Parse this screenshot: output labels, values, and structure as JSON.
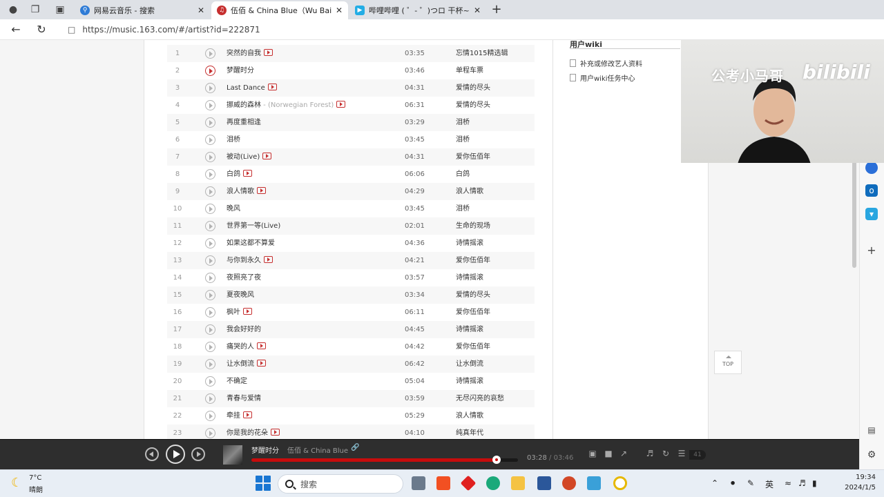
{
  "browser": {
    "tabs": [
      {
        "label": "网易云音乐 - 搜索",
        "favicon": "search-icon"
      },
      {
        "label": "伍佰 & China Blue（Wu Bai & C",
        "favicon": "netease-music-icon"
      },
      {
        "label": "哔哩哔哩 ( ゜- ゜)つロ 干杯~-bili",
        "favicon": "bilibili-icon"
      }
    ],
    "url": "https://music.163.com/#/artist?id=222871"
  },
  "songs": [
    {
      "num": "1",
      "title": "突然的自我",
      "sub": "",
      "mv": true,
      "duration": "03:35",
      "album": "忘情1015精选辑",
      "playing": false
    },
    {
      "num": "2",
      "title": "梦醒时分",
      "sub": "",
      "mv": false,
      "duration": "03:46",
      "album": "单程车票",
      "playing": true
    },
    {
      "num": "3",
      "title": "Last Dance",
      "sub": "",
      "mv": true,
      "duration": "04:31",
      "album": "爱情的尽头",
      "playing": false
    },
    {
      "num": "4",
      "title": "挪威的森林",
      "sub": " - (Norwegian Forest)",
      "mv": true,
      "duration": "06:31",
      "album": "爱情的尽头",
      "playing": false
    },
    {
      "num": "5",
      "title": "再度重相逢",
      "sub": "",
      "mv": false,
      "duration": "03:29",
      "album": "泪桥",
      "playing": false
    },
    {
      "num": "6",
      "title": "泪桥",
      "sub": "",
      "mv": false,
      "duration": "03:45",
      "album": "泪桥",
      "playing": false
    },
    {
      "num": "7",
      "title": "被动(Live)",
      "sub": "",
      "mv": true,
      "duration": "04:31",
      "album": "爱你伍佰年",
      "playing": false
    },
    {
      "num": "8",
      "title": "白鸽",
      "sub": "",
      "mv": true,
      "duration": "06:06",
      "album": "白鸽",
      "playing": false
    },
    {
      "num": "9",
      "title": "浪人情歌",
      "sub": "",
      "mv": true,
      "duration": "04:29",
      "album": "浪人情歌",
      "playing": false
    },
    {
      "num": "10",
      "title": "晚风",
      "sub": "",
      "mv": false,
      "duration": "03:45",
      "album": "泪桥",
      "playing": false
    },
    {
      "num": "11",
      "title": "世界第一等(Live)",
      "sub": "",
      "mv": false,
      "duration": "02:01",
      "album": "生命的现场",
      "playing": false
    },
    {
      "num": "12",
      "title": "如果这都不算爱",
      "sub": "",
      "mv": false,
      "duration": "04:36",
      "album": "诗情摇滚",
      "playing": false
    },
    {
      "num": "13",
      "title": "与你到永久",
      "sub": "",
      "mv": true,
      "duration": "04:21",
      "album": "爱你伍佰年",
      "playing": false
    },
    {
      "num": "14",
      "title": "夜照亮了夜",
      "sub": "",
      "mv": false,
      "duration": "03:57",
      "album": "诗情摇滚",
      "playing": false
    },
    {
      "num": "15",
      "title": "夏夜晚风",
      "sub": "",
      "mv": false,
      "duration": "03:34",
      "album": "爱情的尽头",
      "playing": false
    },
    {
      "num": "16",
      "title": "枫叶",
      "sub": "",
      "mv": true,
      "duration": "06:11",
      "album": "爱你伍佰年",
      "playing": false
    },
    {
      "num": "17",
      "title": "我会好好的",
      "sub": "",
      "mv": false,
      "duration": "04:45",
      "album": "诗情摇滚",
      "playing": false
    },
    {
      "num": "18",
      "title": "痛哭的人",
      "sub": "",
      "mv": true,
      "duration": "04:42",
      "album": "爱你伍佰年",
      "playing": false
    },
    {
      "num": "19",
      "title": "让水倒流",
      "sub": "",
      "mv": true,
      "duration": "06:42",
      "album": "让水倒流",
      "playing": false
    },
    {
      "num": "20",
      "title": "不确定",
      "sub": "",
      "mv": false,
      "duration": "05:04",
      "album": "诗情摇滚",
      "playing": false
    },
    {
      "num": "21",
      "title": "青春与爱情",
      "sub": "",
      "mv": false,
      "duration": "03:59",
      "album": "无尽闪亮的哀愁",
      "playing": false
    },
    {
      "num": "22",
      "title": "牵挂",
      "sub": "",
      "mv": true,
      "duration": "05:29",
      "album": "浪人情歌",
      "playing": false
    },
    {
      "num": "23",
      "title": "你是我的花朵",
      "sub": "",
      "mv": true,
      "duration": "04:10",
      "album": "纯真年代",
      "playing": false
    }
  ],
  "wiki": {
    "title": "用户wiki",
    "links": [
      "补充或修改艺人资料",
      "用户wiki任务中心"
    ]
  },
  "top_button": "TOP",
  "webcam": {
    "brand_text": "公考小马哥",
    "logo_text": "bilibili"
  },
  "player": {
    "song": "梦醒时分",
    "artist": "伍佰 & China Blue",
    "elapsed": "03:28",
    "total": "03:46",
    "progress": 0.92,
    "playlist_count": "41"
  },
  "taskbar": {
    "temp": "7°C",
    "weather": "晴朗",
    "search_placeholder": "搜索",
    "ime": "英",
    "time": "19:34",
    "date": "2024/1/5"
  },
  "colors": {
    "accent": "#c62f2f",
    "progress": "#c70c0c",
    "player_bg": "#2e2e2e"
  }
}
